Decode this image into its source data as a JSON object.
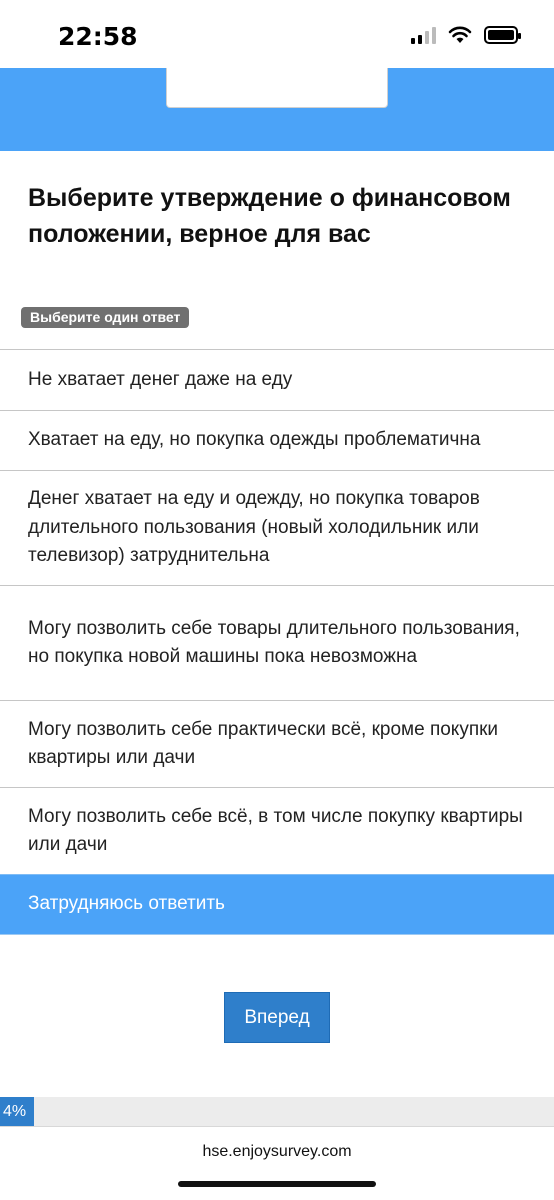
{
  "status_bar": {
    "time": "22:58"
  },
  "question": {
    "title": "Выберите утверждение о финансовом положении, верное для вас",
    "hint": "Выберите один ответ"
  },
  "options": [
    {
      "label": "Не хватает денег даже на еду",
      "selected": false
    },
    {
      "label": "Хватает на еду, но покупка одежды проблематична",
      "selected": false
    },
    {
      "label": "Денег хватает на еду и одежду, но покупка товаров длительного пользования (новый холодильник или телевизор) затруднительна",
      "selected": false
    },
    {
      "label": "Могу позволить себе товары длительного пользования, но покупка новой машины пока невозможна",
      "selected": false
    },
    {
      "label": "Могу позволить себе практически всё, кроме покупки квартиры или дачи",
      "selected": false
    },
    {
      "label": "Могу позволить себе всё, в том числе покупку квартиры или дачи",
      "selected": false
    },
    {
      "label": "Затрудняюсь ответить",
      "selected": true
    }
  ],
  "next_button": {
    "label": "Вперед"
  },
  "progress": {
    "label": "4%",
    "value_percent": 4
  },
  "footer": {
    "url": "hse.enjoysurvey.com"
  },
  "colors": {
    "accent": "#4ba3f8",
    "button": "#2f7fcb",
    "hint_badge": "#707070"
  },
  "icons": [
    "cellular-signal-icon",
    "wifi-icon",
    "battery-icon"
  ]
}
